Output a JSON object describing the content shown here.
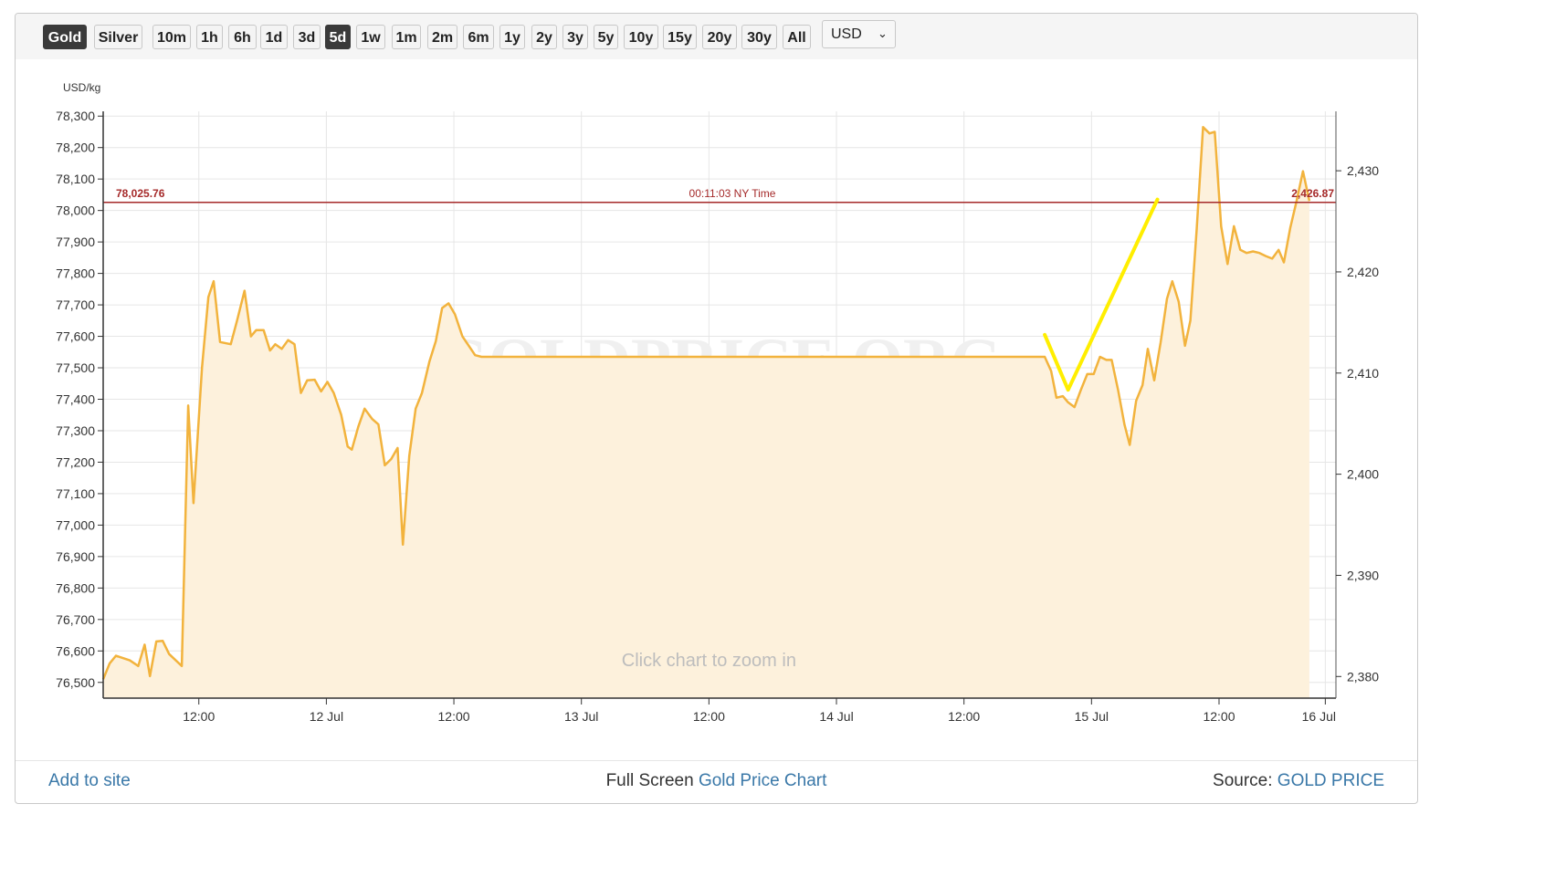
{
  "toolbar": {
    "metals": [
      {
        "label": "Gold",
        "active": true
      },
      {
        "label": "Silver",
        "active": false
      }
    ],
    "ranges": [
      {
        "label": "10m",
        "active": false
      },
      {
        "label": "1h",
        "active": false
      },
      {
        "label": "6h",
        "active": false
      },
      {
        "label": "1d",
        "active": false
      },
      {
        "label": "3d",
        "active": false
      },
      {
        "label": "5d",
        "active": true
      },
      {
        "label": "1w",
        "active": false
      },
      {
        "label": "1m",
        "active": false
      },
      {
        "label": "2m",
        "active": false
      },
      {
        "label": "6m",
        "active": false
      },
      {
        "label": "1y",
        "active": false
      },
      {
        "label": "2y",
        "active": false
      },
      {
        "label": "3y",
        "active": false
      },
      {
        "label": "5y",
        "active": false
      },
      {
        "label": "10y",
        "active": false
      },
      {
        "label": "15y",
        "active": false
      },
      {
        "label": "20y",
        "active": false
      },
      {
        "label": "30y",
        "active": false
      },
      {
        "label": "All",
        "active": false
      }
    ],
    "currency": "USD"
  },
  "chart_data": {
    "type": "area",
    "unit_label": "USD/kg",
    "watermark": "GOLDPRICE.ORG",
    "zoom_hint": "Click chart to zoom in",
    "x_tick_labels": [
      "12:00",
      "12 Jul",
      "12:00",
      "13 Jul",
      "12:00",
      "14 Jul",
      "12:00",
      "15 Jul",
      "12:00",
      "16 Jul"
    ],
    "x_tick_hours": [
      12,
      24,
      36,
      48,
      60,
      72,
      84,
      96,
      108,
      118
    ],
    "x_range_hours": [
      3,
      119
    ],
    "y_left": {
      "min": 76450,
      "max": 78350,
      "ticks": [
        76500,
        76600,
        76700,
        76800,
        76900,
        77000,
        77100,
        77200,
        77300,
        77400,
        77500,
        77600,
        77700,
        77800,
        77900,
        78000,
        78100,
        78200,
        78300
      ]
    },
    "y_left_labels": [
      "76,500",
      "76,600",
      "76,700",
      "76,800",
      "76,900",
      "77,000",
      "77,100",
      "77,200",
      "77,300",
      "77,400",
      "77,500",
      "77,600",
      "77,700",
      "77,800",
      "77,900",
      "78,000",
      "78,100",
      "78,200",
      "78,300"
    ],
    "y_right": {
      "ticks": [
        2380,
        2390,
        2400,
        2410,
        2420,
        2430
      ]
    },
    "y_right_labels": [
      "2,380",
      "2,390",
      "2,400",
      "2,410",
      "2,420",
      "2,430"
    ],
    "current_line": {
      "value_kg": 78025.76,
      "left_label": "78,025.76",
      "center_label": "00:11:03 NY Time",
      "right_label": "2,426.87"
    },
    "series": [
      {
        "points": [
          [
            3,
            76510
          ],
          [
            3.6,
            76560
          ],
          [
            4.2,
            76585
          ],
          [
            5.5,
            76570
          ],
          [
            6.3,
            76552
          ],
          [
            6.9,
            76620
          ],
          [
            7.4,
            76520
          ],
          [
            8.0,
            76630
          ],
          [
            8.6,
            76632
          ],
          [
            9.2,
            76590
          ],
          [
            10.4,
            76552
          ],
          [
            11.0,
            77380
          ],
          [
            11.5,
            77070
          ],
          [
            12.3,
            77500
          ],
          [
            12.9,
            77725
          ],
          [
            13.4,
            77775
          ],
          [
            14.0,
            77582
          ],
          [
            15.0,
            77575
          ],
          [
            15.6,
            77650
          ],
          [
            16.3,
            77745
          ],
          [
            16.9,
            77600
          ],
          [
            17.4,
            77620
          ],
          [
            18.1,
            77620
          ],
          [
            18.7,
            77555
          ],
          [
            19.2,
            77575
          ],
          [
            19.8,
            77560
          ],
          [
            20.4,
            77588
          ],
          [
            21.0,
            77575
          ],
          [
            21.6,
            77420
          ],
          [
            22.2,
            77460
          ],
          [
            22.9,
            77462
          ],
          [
            23.5,
            77425
          ],
          [
            24.1,
            77455
          ],
          [
            24.7,
            77420
          ],
          [
            25.4,
            77350
          ],
          [
            26.0,
            77250
          ],
          [
            26.4,
            77240
          ],
          [
            27.0,
            77312
          ],
          [
            27.6,
            77370
          ],
          [
            28.3,
            77338
          ],
          [
            28.9,
            77320
          ],
          [
            29.5,
            77190
          ],
          [
            30.1,
            77210
          ],
          [
            30.7,
            77245
          ],
          [
            31.2,
            76938
          ],
          [
            31.8,
            77220
          ],
          [
            32.4,
            77370
          ],
          [
            33.0,
            77420
          ],
          [
            33.7,
            77520
          ],
          [
            34.3,
            77585
          ],
          [
            34.9,
            77690
          ],
          [
            35.5,
            77705
          ],
          [
            36.1,
            77670
          ],
          [
            36.8,
            77600
          ],
          [
            37.5,
            77565
          ],
          [
            38.0,
            77540
          ],
          [
            38.6,
            77535
          ],
          [
            47.0,
            77535
          ],
          [
            60.0,
            77535
          ],
          [
            72.0,
            77535
          ],
          [
            91.6,
            77535
          ],
          [
            92.2,
            77490
          ],
          [
            92.7,
            77405
          ],
          [
            93.3,
            77410
          ],
          [
            93.8,
            77390
          ],
          [
            94.4,
            77375
          ],
          [
            95.0,
            77430
          ],
          [
            95.6,
            77480
          ],
          [
            96.2,
            77480
          ],
          [
            96.8,
            77535
          ],
          [
            97.4,
            77525
          ],
          [
            97.9,
            77525
          ],
          [
            98.5,
            77430
          ],
          [
            99.1,
            77320
          ],
          [
            99.6,
            77255
          ],
          [
            100.2,
            77395
          ],
          [
            100.8,
            77445
          ],
          [
            101.3,
            77560
          ],
          [
            101.9,
            77460
          ],
          [
            102.5,
            77580
          ],
          [
            103.1,
            77720
          ],
          [
            103.6,
            77775
          ],
          [
            104.2,
            77710
          ],
          [
            104.8,
            77570
          ],
          [
            105.3,
            77650
          ],
          [
            105.9,
            77940
          ],
          [
            106.5,
            78265
          ],
          [
            107.1,
            78245
          ],
          [
            107.6,
            78250
          ],
          [
            108.2,
            77950
          ],
          [
            108.8,
            77830
          ],
          [
            109.4,
            77950
          ],
          [
            110.0,
            77875
          ],
          [
            110.6,
            77865
          ],
          [
            111.2,
            77870
          ],
          [
            111.8,
            77865
          ],
          [
            112.4,
            77855
          ],
          [
            113.0,
            77847
          ],
          [
            113.6,
            77875
          ],
          [
            114.1,
            77835
          ],
          [
            114.7,
            77945
          ],
          [
            115.3,
            78030
          ],
          [
            115.9,
            78125
          ],
          [
            116.5,
            78030
          ]
        ]
      }
    ],
    "annotation_stroke": {
      "color": "#ffee00",
      "points": [
        [
          91.6,
          77605
        ],
        [
          93.8,
          77430
        ],
        [
          102.2,
          78035
        ]
      ]
    },
    "colors": {
      "line": "#f2b33d",
      "fill": "#fdf1dc",
      "current_line": "#a52a2a",
      "grid": "#e6e6e6",
      "annotation": "#ffee00"
    }
  },
  "footer": {
    "add_to_site": "Add to site",
    "center_prefix": "Full Screen ",
    "center_link": "Gold Price Chart",
    "source_prefix": "Source: ",
    "source_link": "GOLD PRICE"
  }
}
